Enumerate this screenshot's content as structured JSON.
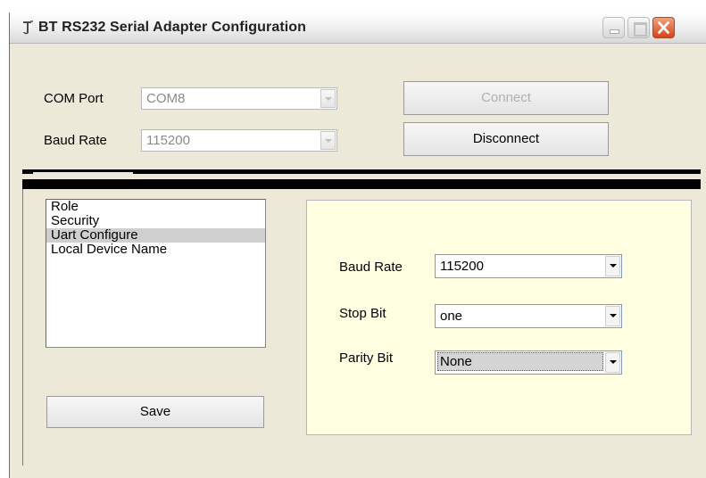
{
  "window": {
    "title": "BT RS232 Serial Adapter Configuration"
  },
  "connection": {
    "com_port_label": "COM Port",
    "com_port_value": "COM8",
    "baud_rate_label": "Baud Rate",
    "baud_rate_value": "115200",
    "connect_label": "Connect",
    "disconnect_label": "Disconnect"
  },
  "menu": {
    "items": [
      "Role",
      "Security",
      "Uart Configure",
      "Local Device Name"
    ],
    "selected": "Uart Configure"
  },
  "uart": {
    "baud_rate_label": "Baud Rate",
    "baud_rate_value": "115200",
    "stop_bit_label": "Stop Bit",
    "stop_bit_value": "one",
    "parity_bit_label": "Parity Bit",
    "parity_bit_value": "None"
  },
  "save_label": "Save",
  "colors": {
    "panel_background": "#ffffe2",
    "close_button": "#d1461d",
    "selection": "#cfcfcf"
  }
}
